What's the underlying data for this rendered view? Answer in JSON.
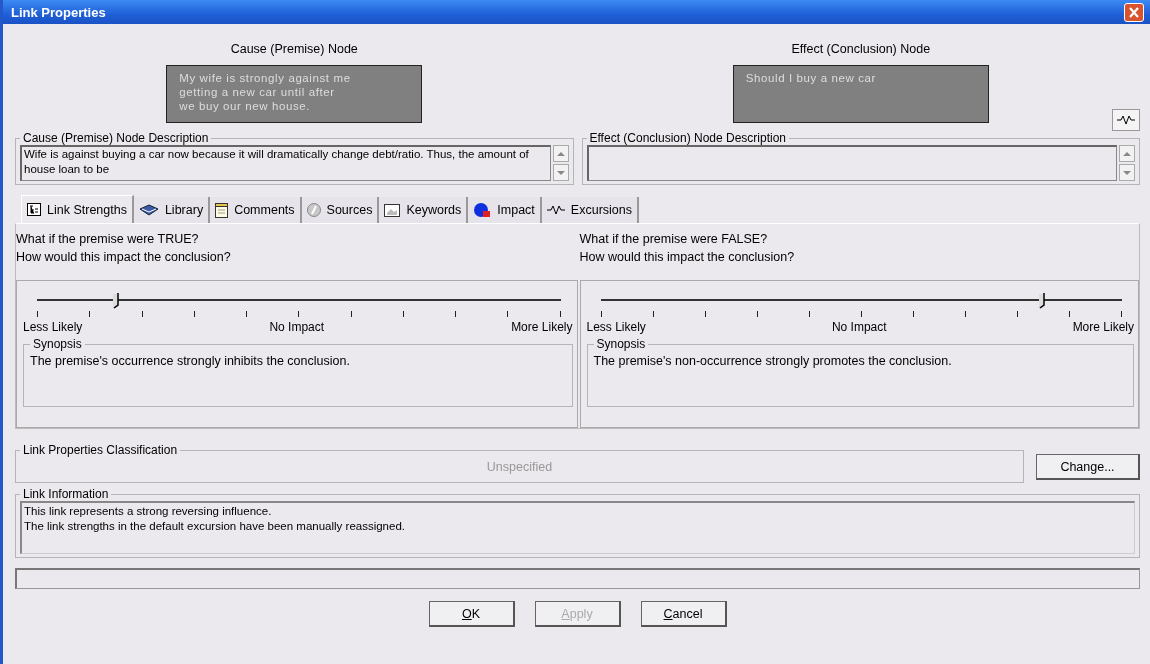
{
  "window": {
    "title": "Link Properties"
  },
  "cause": {
    "heading": "Cause (Premise) Node",
    "node_text": "My wife is strongly against me getting a new car until after we buy our new house.",
    "description_label": "Cause (Premise) Node Description",
    "description": "Wife is against buying a car now because it will dramatically change debt/ratio.  Thus, the amount of house loan to be"
  },
  "effect": {
    "heading": "Effect (Conclusion) Node",
    "node_text": "Should I buy a new car",
    "description_label": "Effect (Conclusion) Node Description"
  },
  "tabs": [
    {
      "label": "Link Strengths",
      "selected": true
    },
    {
      "label": "Library",
      "selected": false
    },
    {
      "label": "Comments",
      "selected": false
    },
    {
      "label": "Sources",
      "selected": false
    },
    {
      "label": "Keywords",
      "selected": false
    },
    {
      "label": "Impact",
      "selected": false
    },
    {
      "label": "Excursions",
      "selected": false
    }
  ],
  "strengths": [
    {
      "question": "What if the premise were TRUE?",
      "question_2": "How would this impact the conclusion?",
      "level": 0.155,
      "left_label": "Less Likely",
      "middle_label": "No Impact",
      "right_label": "More Likely",
      "synopsis_label": "Synopsis",
      "synopsis": "The premise's occurrence strongly inhibits the conclusion."
    },
    {
      "question": "What if the premise were FALSE?",
      "question_2": "How would this impact the conclusion?",
      "level": 0.85,
      "left_label": "Less Likely",
      "middle_label": "No Impact",
      "right_label": "More Likely",
      "synopsis_label": "Synopsis",
      "synopsis": "The premise's non-occurrence strongly promotes the conclusion."
    }
  ],
  "classification": {
    "label": "Link Properties Classification",
    "value": "Unspecified",
    "button": "Change..."
  },
  "information": {
    "label": "Link Information",
    "lines": [
      "This link represents a strong reversing influence.",
      "The link strengths in the default excursion have been manually reassigned."
    ]
  },
  "buttons": [
    {
      "label": "OK",
      "disabled": false
    },
    {
      "label": "Apply",
      "disabled": true
    },
    {
      "label": "Cancel",
      "disabled": false
    }
  ]
}
